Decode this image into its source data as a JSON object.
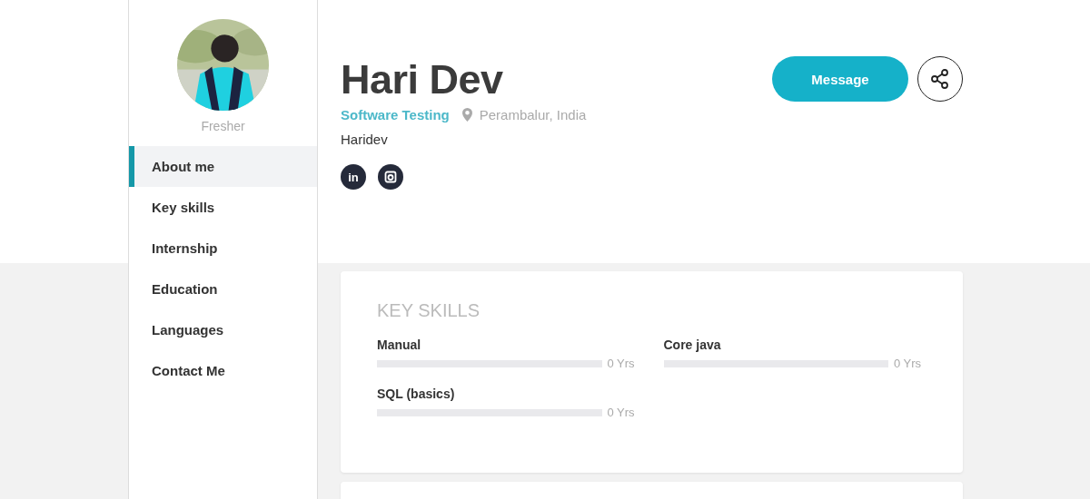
{
  "sidebar": {
    "status": "Fresher",
    "items": [
      {
        "label": "About me",
        "selected": true
      },
      {
        "label": "Key skills",
        "selected": false
      },
      {
        "label": "Internship",
        "selected": false
      },
      {
        "label": "Education",
        "selected": false
      },
      {
        "label": "Languages",
        "selected": false
      },
      {
        "label": "Contact Me",
        "selected": false
      }
    ]
  },
  "profile": {
    "name": "Hari Dev",
    "role": "Software Testing",
    "location": "Perambalur, India",
    "username": "Haridev",
    "social": [
      {
        "kind": "text",
        "label": "in"
      },
      {
        "kind": "camera"
      }
    ],
    "message_button": "Message"
  },
  "key_skills": {
    "title": "KEY SKILLS",
    "skills": [
      {
        "name": "Manual",
        "level": 0,
        "reading": "0 Yrs"
      },
      {
        "name": "Core java",
        "level": 0,
        "reading": "0 Yrs"
      },
      {
        "name": "SQL (basics)",
        "level": 0,
        "reading": "0 Yrs"
      }
    ]
  }
}
